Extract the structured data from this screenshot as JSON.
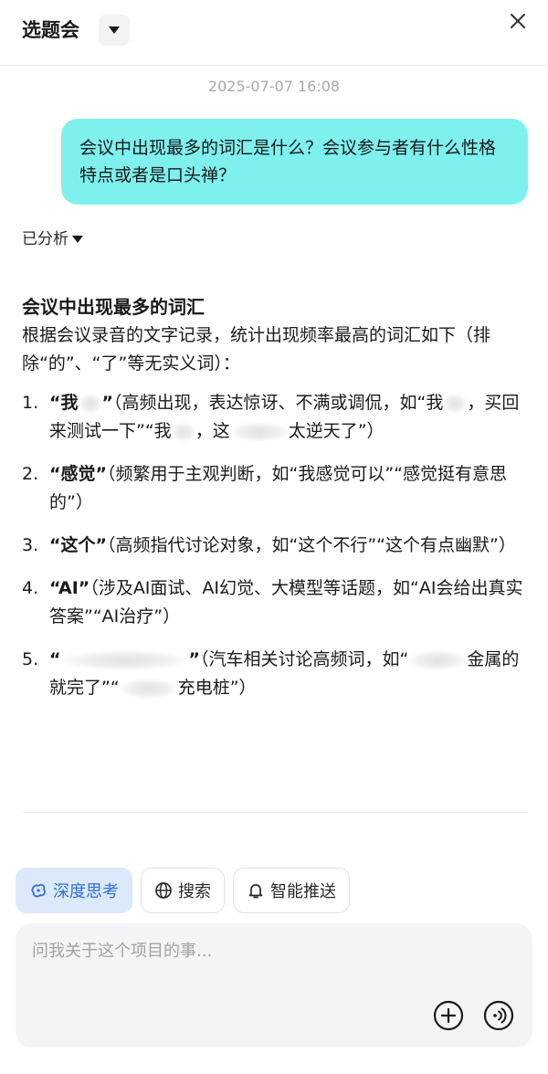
{
  "header": {
    "title": "选题会"
  },
  "chat": {
    "timestamp": "2025-07-07 16:08",
    "user_message": "会议中出现最多的词汇是什么？会议参与者有什么性格特点或者是口头禅？",
    "analyzed_label": "已分析"
  },
  "answer": {
    "heading": "会议中出现最多的词汇",
    "intro": "根据会议录音的文字记录，统计出现频率最高的词汇如下（排除“的”、“了”等无实义词）：",
    "items": [
      {
        "num": "1.",
        "term_open": "“我",
        "term_close": "”",
        "text_a": "（高频出现，表达惊讶、不满或调侃，如“我",
        "text_b": "，买回来测试一下”“我",
        "text_c": "，这",
        "text_d": "太逆天了”）"
      },
      {
        "num": "2.",
        "term": "“感觉”",
        "text": "（频繁用于主观判断，如“我感觉可以”“感觉挺有意思的”）"
      },
      {
        "num": "3.",
        "term": "“这个”",
        "text": "（高频指代讨论对象，如“这个不行”“这个有点幽默”）"
      },
      {
        "num": "4.",
        "term": "“AI”",
        "text": "（涉及AI面试、AI幻觉、大模型等话题，如“AI会给出真实答案”“AI治疗”）"
      },
      {
        "num": "5.",
        "term_open": "“",
        "term_close": "”",
        "text_a": "（汽车相关讨论高频词，如“",
        "text_b": "金属的就完了”“",
        "text_c": "充电桩”）"
      }
    ]
  },
  "toolbar": {
    "deep_think": "深度思考",
    "search": "搜索",
    "smart_push": "智能推送"
  },
  "input": {
    "placeholder": "问我关于这个项目的事..."
  },
  "colors": {
    "user_bubble": "#7ef0ee",
    "active_chip_bg": "#dbe9fb",
    "active_chip_text": "#2f6fd6"
  }
}
